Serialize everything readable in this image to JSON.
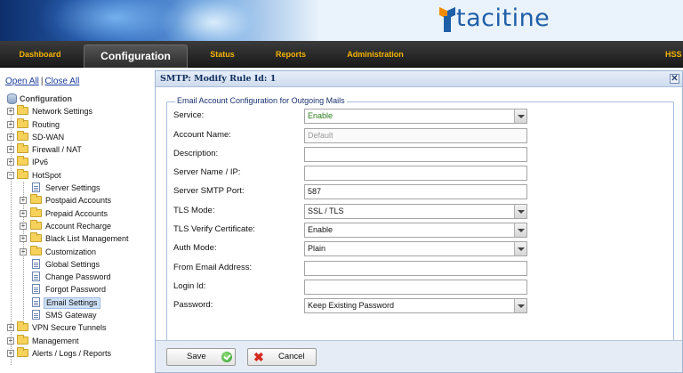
{
  "brand": {
    "logo_text": "tacitine"
  },
  "nav": {
    "items": [
      "Dashboard",
      "Configuration",
      "Status",
      "Reports",
      "Administration",
      "HSS"
    ],
    "active": "Configuration"
  },
  "sidebar": {
    "open_all": "Open All",
    "separator": "|",
    "close_all": "Close All",
    "root": "Configuration",
    "items": [
      "Network Settings",
      "Routing",
      "SD-WAN",
      "Firewall / NAT",
      "IPv6",
      "HotSpot",
      "Server Settings",
      "Postpaid Accounts",
      "Prepaid Accounts",
      "Account Recharge",
      "Black List Management",
      "Customization",
      "Global Settings",
      "Change Password",
      "Forgot Password",
      "Email Settings",
      "SMS Gateway",
      "VPN Secure Tunnels",
      "Management",
      "Alerts / Logs / Reports"
    ],
    "selected": "Email Settings"
  },
  "panel": {
    "title": "SMTP: Modify Rule Id: 1",
    "close": "✕",
    "legend": "Email Account Configuration for Outgoing Mails"
  },
  "form": {
    "service": {
      "label": "Service:",
      "value": "Enable"
    },
    "account_name": {
      "label": "Account Name:",
      "value": "Default"
    },
    "description": {
      "label": "Description:",
      "value": ""
    },
    "server_name": {
      "label": "Server Name / IP:",
      "value": ""
    },
    "smtp_port": {
      "label": "Server SMTP Port:",
      "value": "587"
    },
    "tls_mode": {
      "label": "TLS Mode:",
      "value": "SSL / TLS"
    },
    "tls_verify": {
      "label": "TLS Verify Certificate:",
      "value": "Enable"
    },
    "auth_mode": {
      "label": "Auth Mode:",
      "value": "Plain"
    },
    "from_email": {
      "label": "From Email Address:",
      "value": ""
    },
    "login_id": {
      "label": "Login Id:",
      "value": ""
    },
    "password": {
      "label": "Password:",
      "value": "Keep Existing Password"
    }
  },
  "buttons": {
    "save": "Save",
    "cancel": "Cancel"
  },
  "colors": {
    "nav_text": "#f5b400",
    "link": "#1a3d9b",
    "enable_green": "#2a7d1b",
    "panel_title": "#12305f"
  }
}
